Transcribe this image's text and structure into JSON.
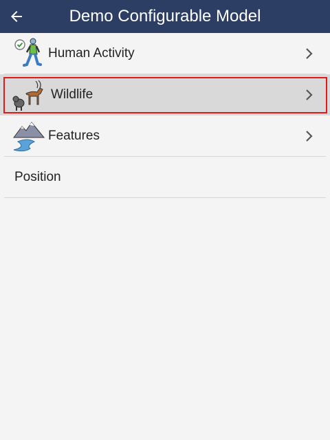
{
  "app_bar": {
    "title": "Demo Configurable Model",
    "back_icon": "arrow-left-icon",
    "background": "#2c3e63"
  },
  "items": [
    {
      "label": "Human Activity",
      "icon": "walking-person-icon",
      "has_chevron": true,
      "selected": false
    },
    {
      "label": "Wildlife",
      "icon": "antelope-monkey-icon",
      "has_chevron": true,
      "selected": true
    },
    {
      "label": "Features",
      "icon": "mountain-river-icon",
      "has_chevron": true,
      "selected": false
    },
    {
      "label": "Position",
      "icon": "",
      "has_chevron": false,
      "selected": false
    }
  ],
  "colors": {
    "selection_border": "#e01818",
    "selected_background": "#d9d9d9",
    "page_background": "#f4f4f4"
  }
}
